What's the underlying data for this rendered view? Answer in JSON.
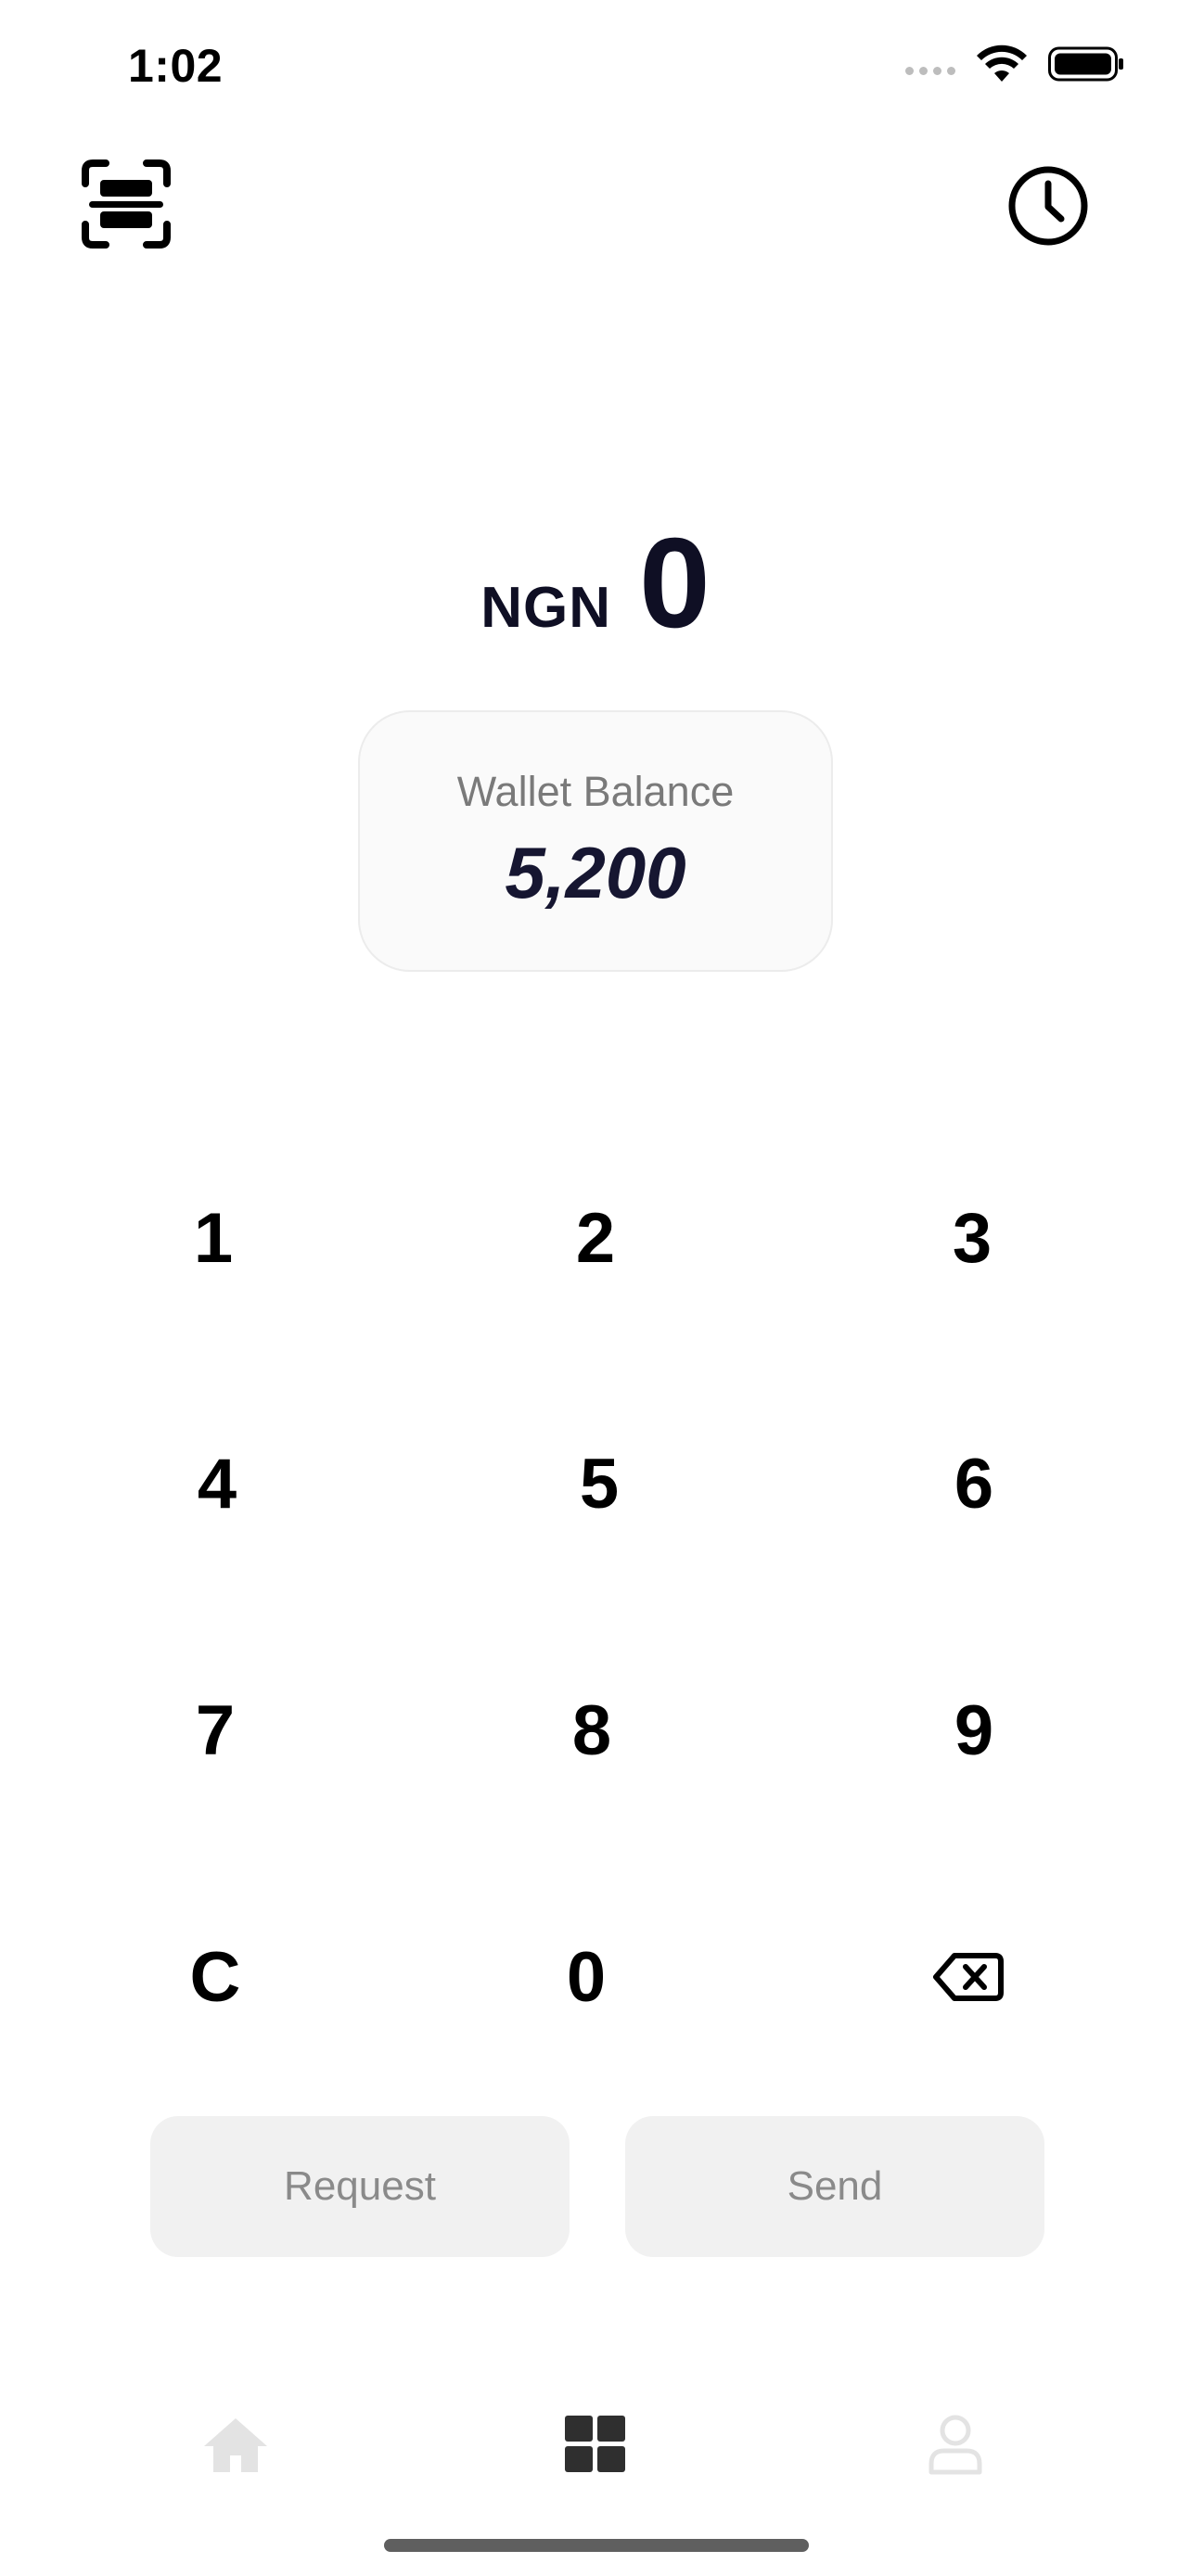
{
  "status_bar": {
    "time": "1:02",
    "icons": [
      "signal-icon",
      "wifi-icon",
      "battery-icon"
    ]
  },
  "header": {
    "left_icon": "scan-icon",
    "right_icon": "history-icon"
  },
  "amount": {
    "currency": "NGN",
    "value": "0"
  },
  "wallet": {
    "label": "Wallet Balance",
    "value": "5,200"
  },
  "keypad": {
    "keys": [
      "1",
      "2",
      "3",
      "4",
      "5",
      "6",
      "7",
      "8",
      "9",
      "C",
      "0"
    ],
    "backspace_icon": "backspace-icon"
  },
  "actions": {
    "request_label": "Request",
    "send_label": "Send"
  },
  "tab_bar": {
    "items": [
      "home-icon",
      "grid-icon",
      "profile-icon"
    ],
    "active": "grid-icon"
  },
  "colors": {
    "primary_text": "#0f0f24",
    "muted_text": "#7a7a7a",
    "button_bg": "#f1f1f1",
    "tab_inactive": "#e3e3e3",
    "tab_active": "#2f2f2f"
  }
}
